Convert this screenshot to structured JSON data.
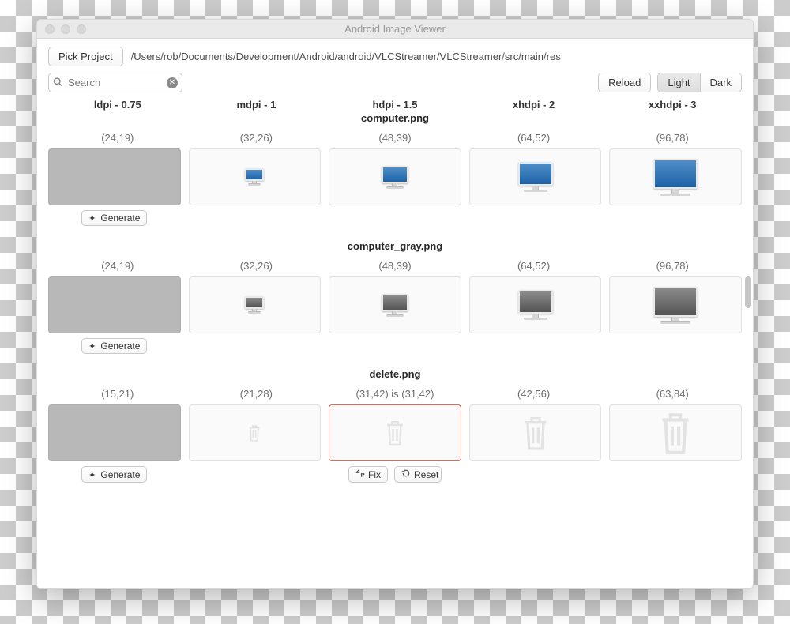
{
  "window": {
    "title": "Android Image Viewer"
  },
  "toolbar": {
    "pick_project": "Pick Project",
    "path": "/Users/rob/Documents/Development/Android/android/VLCStreamer/VLCStreamer/src/main/res",
    "search_placeholder": "Search",
    "reload": "Reload",
    "theme": {
      "light": "Light",
      "dark": "Dark",
      "active": "light"
    }
  },
  "columns": [
    {
      "label": "ldpi - 0.75"
    },
    {
      "label": "mdpi - 1"
    },
    {
      "label": "hdpi - 1.5"
    },
    {
      "label": "xhdpi - 2"
    },
    {
      "label": "xxhdpi - 3"
    }
  ],
  "buttons": {
    "generate": "Generate",
    "fix": "Fix",
    "reset": "Reset"
  },
  "groups": [
    {
      "name": "computer.png",
      "style": "color",
      "dims": [
        "(24,19)",
        "(32,26)",
        "(48,39)",
        "(64,52)",
        "(96,78)"
      ],
      "missing_ldpi": true
    },
    {
      "name": "computer_gray.png",
      "style": "gray",
      "dims": [
        "(24,19)",
        "(32,26)",
        "(48,39)",
        "(64,52)",
        "(96,78)"
      ],
      "missing_ldpi": true
    },
    {
      "name": "delete.png",
      "style": "trash",
      "dims": [
        "(15,21)",
        "(21,28)",
        "(31,42)  is  (31,42)",
        "(42,56)",
        "(63,84)"
      ],
      "missing_ldpi": true,
      "error_index": 2,
      "has_fix": true
    }
  ]
}
